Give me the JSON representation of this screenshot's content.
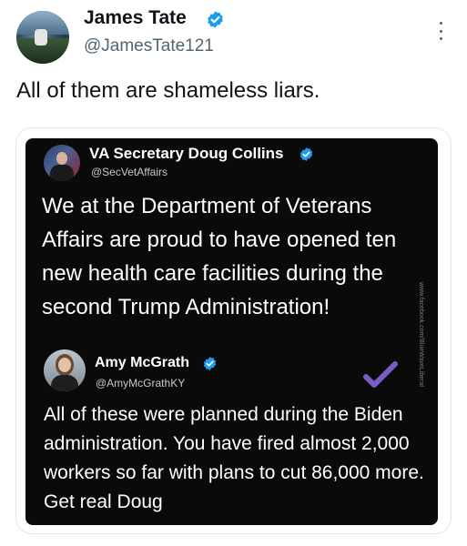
{
  "tweet": {
    "author": {
      "display_name": "James Tate",
      "handle": "@JamesTate121",
      "verified_icon": "verified-badge-icon",
      "verified_color": "#1d9bf0"
    },
    "text": "All of them are shameless liars.",
    "more_icon": "more-options-icon"
  },
  "embedded": {
    "post": {
      "author": "VA Secretary Doug Collins",
      "handle": "@SecVetAffairs",
      "text": "We at the Department of Veterans Affairs are proud to have opened ten new health care facilities during the second Trump Administration!"
    },
    "reply": {
      "author": "Amy McGrath",
      "handle": "@AmyMcGrathKY",
      "text": "All of these were planned during the Biden administration. You have fired almost 2,000 workers so far with plans to cut 86,000 more. Get real Doug",
      "accent_color": "#7b5cc4"
    },
    "watermark": "www.facebook.com/BlueWaveLiberal"
  }
}
